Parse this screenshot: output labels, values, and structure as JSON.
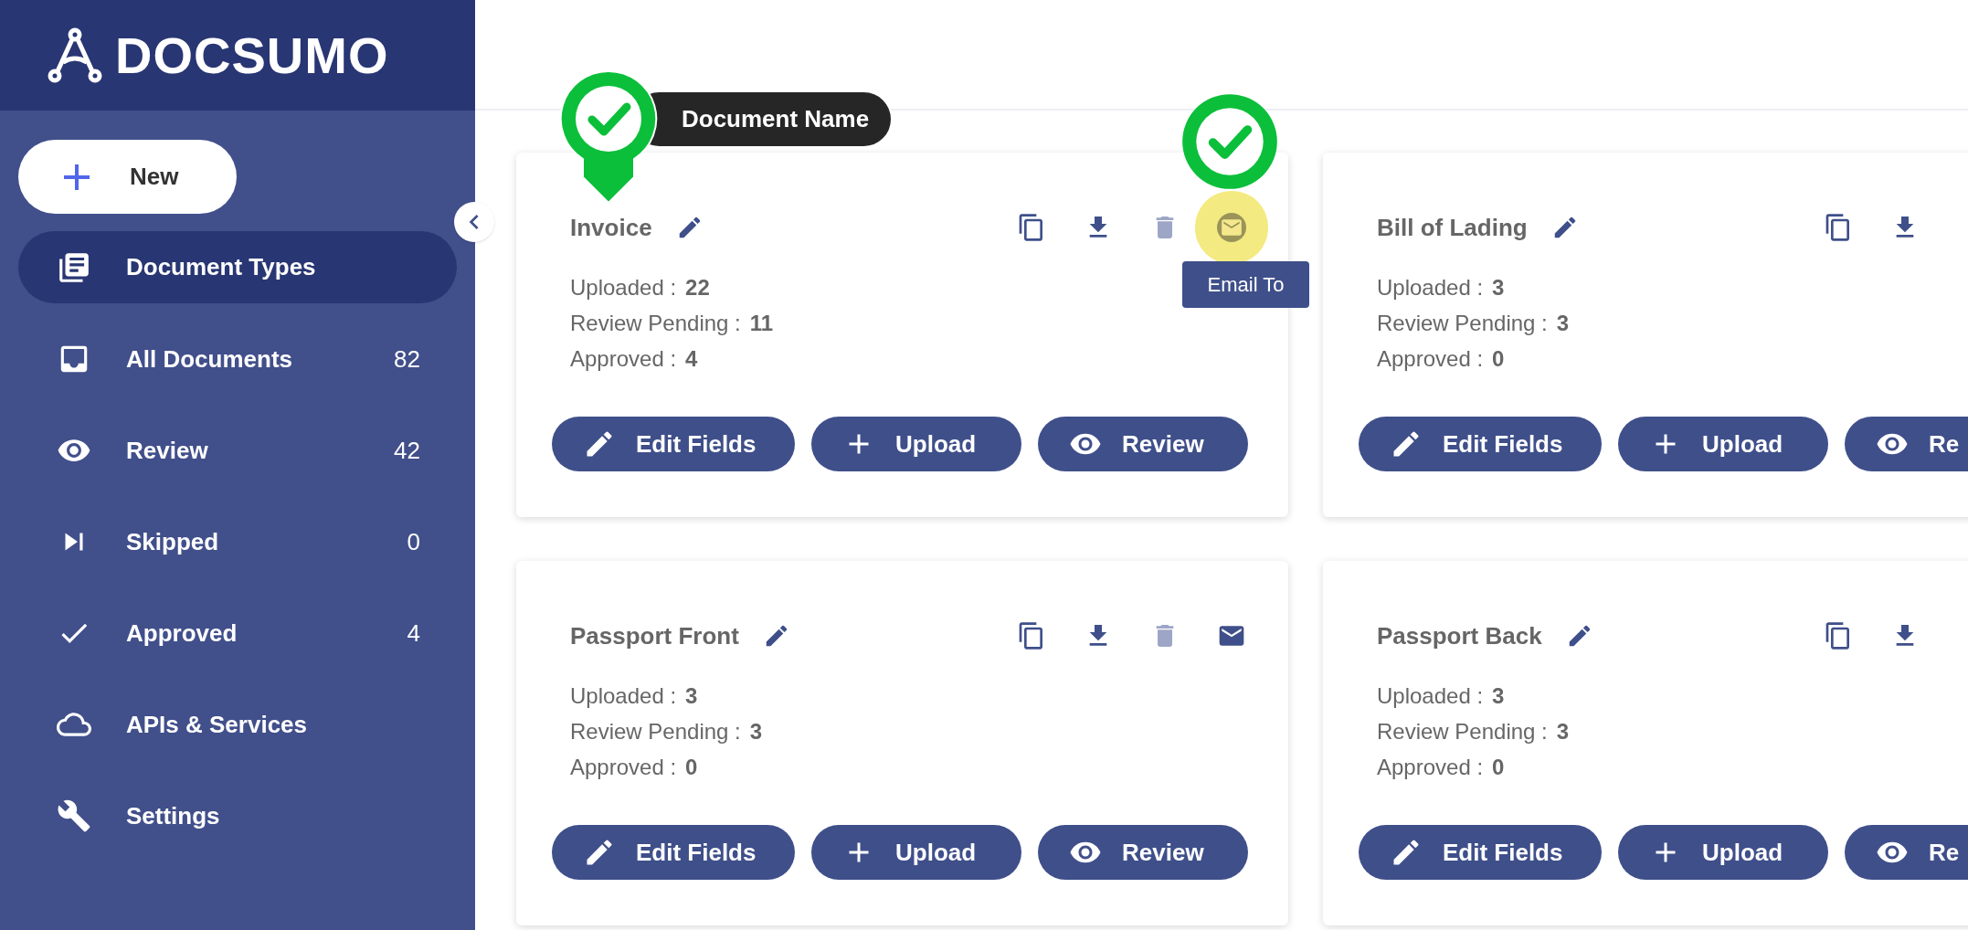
{
  "logo": {
    "text": "DOCSUMO"
  },
  "new_button": {
    "label": "New"
  },
  "sidebar": {
    "items": [
      {
        "kind": "types",
        "label": "Document Types",
        "selected": true
      },
      {
        "kind": "all",
        "label": "All Documents",
        "count": "82",
        "selected": false
      },
      {
        "kind": "review",
        "label": "Review",
        "count": "42",
        "selected": false
      },
      {
        "kind": "skipped",
        "label": "Skipped",
        "count": "0",
        "selected": false
      },
      {
        "kind": "approved",
        "label": "Approved",
        "count": "4",
        "selected": false
      },
      {
        "kind": "apis",
        "label": "APIs & Services",
        "selected": false
      },
      {
        "kind": "settings",
        "label": "Settings",
        "selected": false
      }
    ]
  },
  "cards": [
    {
      "title": "Invoice",
      "stats": [
        {
          "label": "Uploaded :",
          "value": "22"
        },
        {
          "label": "Review Pending :",
          "value": "11"
        },
        {
          "label": "Approved :",
          "value": "4"
        }
      ],
      "actions": [
        {
          "kind": "copy",
          "disabled": false,
          "highlighted": false
        },
        {
          "kind": "download",
          "disabled": false,
          "highlighted": false
        },
        {
          "kind": "delete",
          "disabled": true,
          "highlighted": false
        },
        {
          "kind": "email",
          "disabled": false,
          "highlighted": true
        }
      ],
      "tooltip": "Email To",
      "buttons": [
        {
          "kind": "edit",
          "label": "Edit Fields"
        },
        {
          "kind": "upload",
          "label": "Upload"
        },
        {
          "kind": "review",
          "label": "Review"
        }
      ]
    },
    {
      "title": "Bill of Lading",
      "stats": [
        {
          "label": "Uploaded :",
          "value": "3"
        },
        {
          "label": "Review Pending :",
          "value": "3"
        },
        {
          "label": "Approved :",
          "value": "0"
        }
      ],
      "actions": [
        {
          "kind": "copy",
          "disabled": false,
          "highlighted": false
        },
        {
          "kind": "download",
          "disabled": false,
          "highlighted": false
        }
      ],
      "buttons": [
        {
          "kind": "edit",
          "label": "Edit Fields"
        },
        {
          "kind": "upload",
          "label": "Upload"
        },
        {
          "kind": "review",
          "label": "Re"
        }
      ]
    },
    {
      "title": "Passport Front",
      "stats": [
        {
          "label": "Uploaded :",
          "value": "3"
        },
        {
          "label": "Review Pending :",
          "value": "3"
        },
        {
          "label": "Approved :",
          "value": "0"
        }
      ],
      "actions": [
        {
          "kind": "copy",
          "disabled": false,
          "highlighted": false
        },
        {
          "kind": "download",
          "disabled": false,
          "highlighted": false
        },
        {
          "kind": "delete",
          "disabled": true,
          "highlighted": false
        },
        {
          "kind": "email",
          "disabled": false,
          "highlighted": false
        }
      ],
      "buttons": [
        {
          "kind": "edit",
          "label": "Edit Fields"
        },
        {
          "kind": "upload",
          "label": "Upload"
        },
        {
          "kind": "review",
          "label": "Review"
        }
      ]
    },
    {
      "title": "Passport Back",
      "stats": [
        {
          "label": "Uploaded :",
          "value": "3"
        },
        {
          "label": "Review Pending :",
          "value": "3"
        },
        {
          "label": "Approved :",
          "value": "0"
        }
      ],
      "actions": [
        {
          "kind": "copy",
          "disabled": false,
          "highlighted": false
        },
        {
          "kind": "download",
          "disabled": false,
          "highlighted": false
        }
      ],
      "buttons": [
        {
          "kind": "edit",
          "label": "Edit Fields"
        },
        {
          "kind": "upload",
          "label": "Upload"
        },
        {
          "kind": "review",
          "label": "Re"
        }
      ]
    }
  ],
  "annotations": [
    {
      "kind": "label-marker",
      "label": "Document Name"
    },
    {
      "kind": "check-marker"
    }
  ]
}
